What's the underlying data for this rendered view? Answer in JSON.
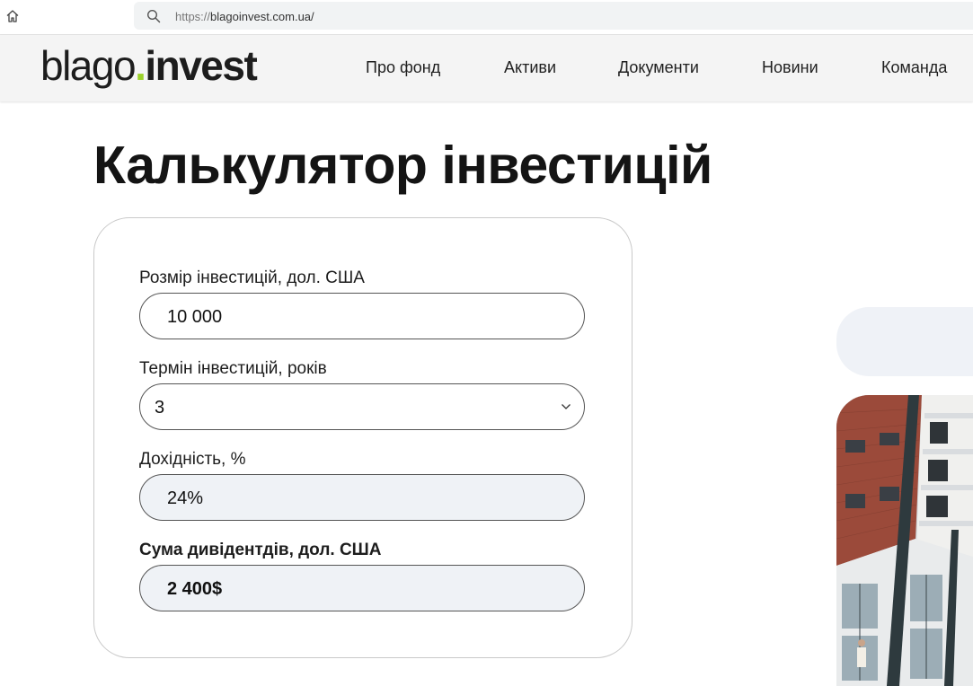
{
  "browser": {
    "url_scheme": "https://",
    "url_host": "blagoinvest.com.ua/"
  },
  "header": {
    "logo_part1": "blago",
    "logo_dot": ".",
    "logo_part2": "invest",
    "nav": [
      "Про фонд",
      "Активи",
      "Документи",
      "Новини",
      "Команда"
    ]
  },
  "page": {
    "title": "Калькулятор інвестицій"
  },
  "calculator": {
    "amount_label": "Розмір інвестицій, дол. США",
    "amount_value": "10 000",
    "term_label": "Термін інвестицій, років",
    "term_value": "3",
    "yield_label": "Дохідність, %",
    "yield_value": "24%",
    "dividends_label": "Сума дивідентдів, дол. США",
    "dividends_value": "2 400$"
  },
  "colors": {
    "logo_accent": "#9bd12a",
    "readonly_field_bg": "#eff2f6",
    "header_bg": "#f4f4f4"
  }
}
